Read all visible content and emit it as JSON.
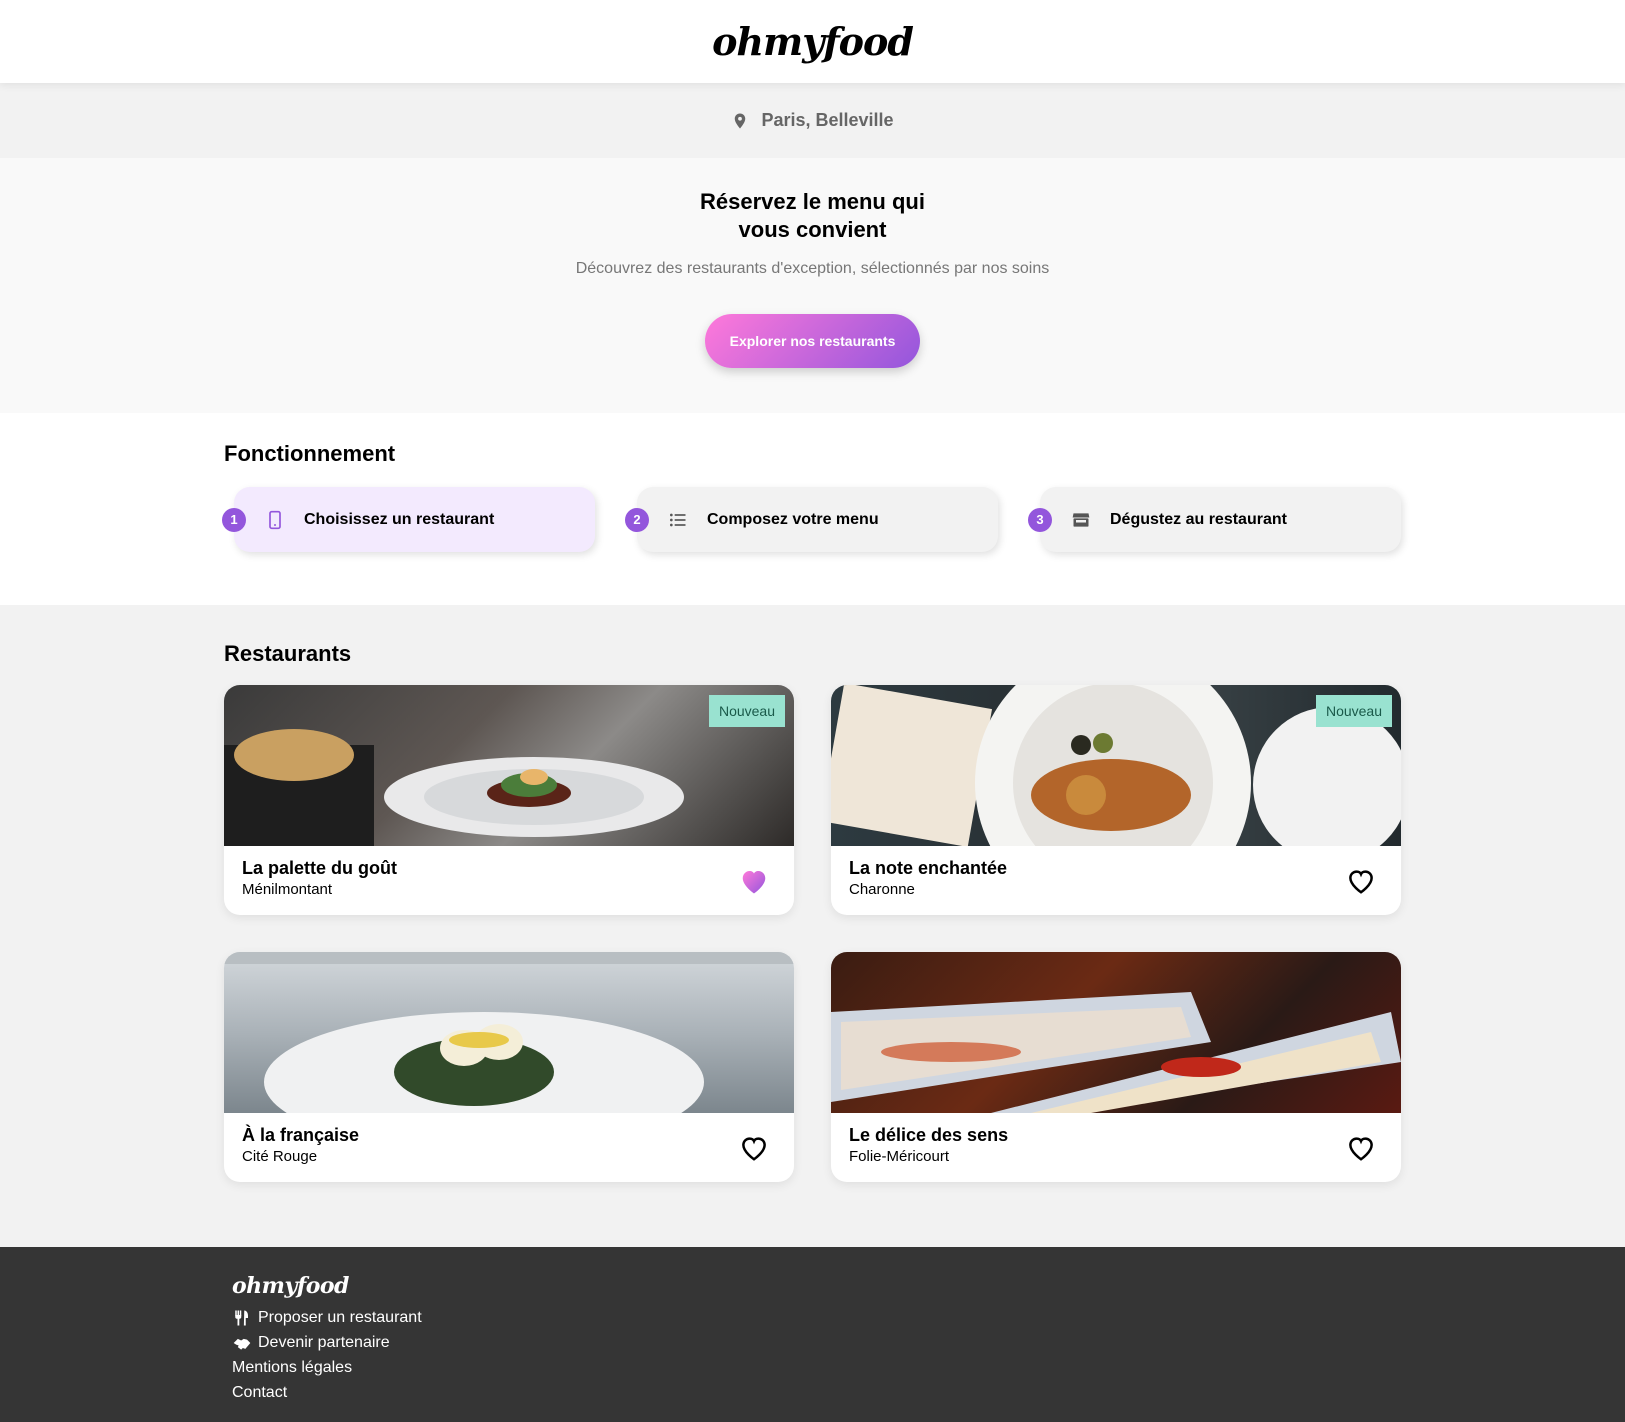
{
  "header": {
    "logo": "ohmyfood"
  },
  "location": {
    "icon": "map-pin-icon",
    "text": "Paris, Belleville"
  },
  "hero": {
    "title": "Réservez le menu qui vous convient",
    "subtitle": "Découvrez des restaurants d'exception, sélectionnés par nos soins",
    "cta_label": "Explorer nos restaurants"
  },
  "process": {
    "title": "Fonctionnement",
    "steps": [
      {
        "number": "1",
        "icon": "smartphone-icon",
        "label": "Choisissez un restaurant",
        "active": true
      },
      {
        "number": "2",
        "icon": "list-icon",
        "label": "Composez votre menu",
        "active": false
      },
      {
        "number": "3",
        "icon": "storefront-icon",
        "label": "Dégustez au restaurant",
        "active": false
      }
    ]
  },
  "restaurants": {
    "title": "Restaurants",
    "items": [
      {
        "name": "La palette du goût",
        "area": "Ménilmontant",
        "badge": "Nouveau",
        "favorite": true
      },
      {
        "name": "La note enchantée",
        "area": "Charonne",
        "badge": "Nouveau",
        "favorite": false
      },
      {
        "name": "À la française",
        "area": "Cité Rouge",
        "badge": "",
        "favorite": false
      },
      {
        "name": "Le délice des sens",
        "area": "Folie-Méricourt",
        "badge": "",
        "favorite": false
      }
    ]
  },
  "footer": {
    "logo": "ohmyfood",
    "links": [
      {
        "icon": "utensils-icon",
        "label": "Proposer un restaurant"
      },
      {
        "icon": "handshake-icon",
        "label": "Devenir partenaire"
      },
      {
        "icon": "",
        "label": "Mentions légales"
      },
      {
        "icon": "",
        "label": "Contact"
      }
    ]
  },
  "colors": {
    "primary_purple": "#9356dc",
    "accent_pink": "#ff79da",
    "badge_green": "#99e2d0",
    "footer_bg": "#353535"
  }
}
